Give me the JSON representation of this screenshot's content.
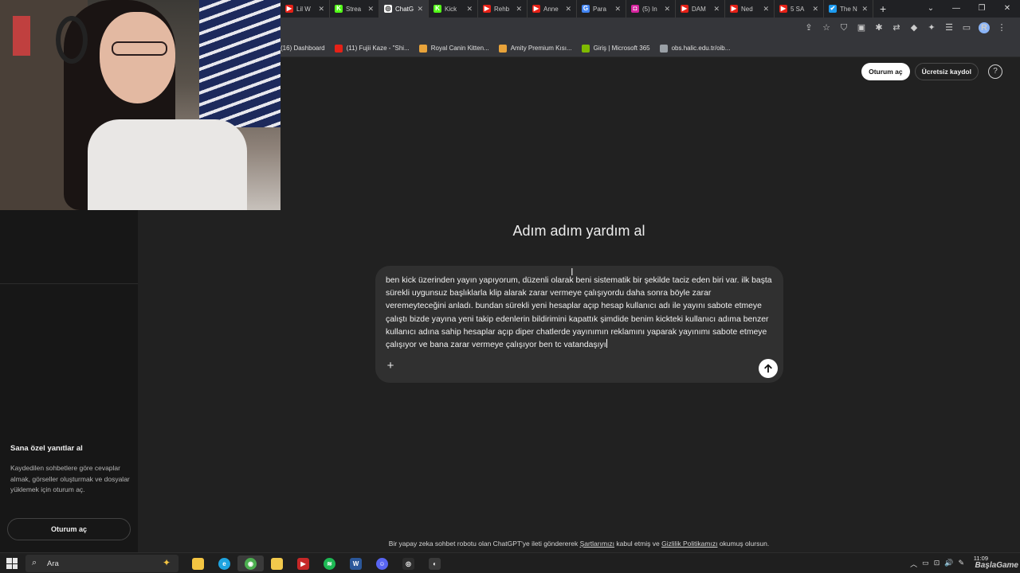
{
  "browser": {
    "tabs": [
      {
        "title": "",
        "fav_color": "#202124",
        "fav_glyph": ""
      },
      {
        "title": "Lil W",
        "fav_color": "#e62117",
        "fav_glyph": "▶"
      },
      {
        "title": "Strea",
        "fav_color": "#53fc18",
        "fav_glyph": "K"
      },
      {
        "title": "ChatG",
        "fav_color": "#ffffff",
        "fav_glyph": "◎",
        "active": true
      },
      {
        "title": "Kick",
        "fav_color": "#53fc18",
        "fav_glyph": "K"
      },
      {
        "title": "Rehb",
        "fav_color": "#e62117",
        "fav_glyph": "▶"
      },
      {
        "title": "Anne",
        "fav_color": "#e62117",
        "fav_glyph": "▶"
      },
      {
        "title": "Para",
        "fav_color": "#4285f4",
        "fav_glyph": "G"
      },
      {
        "title": "(5) In",
        "fav_color": "#d6249f",
        "fav_glyph": "◘"
      },
      {
        "title": "DAM",
        "fav_color": "#e62117",
        "fav_glyph": "▶"
      },
      {
        "title": "Ned",
        "fav_color": "#e62117",
        "fav_glyph": "▶"
      },
      {
        "title": "5 SA",
        "fav_color": "#e62117",
        "fav_glyph": "▶"
      },
      {
        "title": "The N",
        "fav_color": "#1d9bf0",
        "fav_glyph": "✔"
      }
    ],
    "new_tab": "+",
    "window_controls": [
      "⌄",
      "—",
      "❐",
      "✕"
    ],
    "toolbar_icons": [
      "⇪",
      "☆",
      "⛉",
      "▣",
      "✱",
      "⇄",
      "◆",
      "✦",
      "☰",
      "▭"
    ],
    "avatar_letter": "R",
    "menu_icon": "⋮",
    "bookmarks": [
      {
        "label": "(16) Dashboard",
        "color": "#35363a"
      },
      {
        "label": "(11) Fujii Kaze - \"Shi...",
        "color": "#e62117"
      },
      {
        "label": "Royal Canin Kitten...",
        "color": "#e8a33a"
      },
      {
        "label": "Amity Premium Kısı...",
        "color": "#e8a33a"
      },
      {
        "label": "Giriş | Microsoft 365",
        "color": "#7fba00"
      },
      {
        "label": "obs.halic.edu.tr/oib...",
        "color": "#9aa0a6"
      }
    ]
  },
  "header": {
    "login_label": "Oturum aç",
    "signup_label": "Ücretsiz kaydol",
    "help_glyph": "?"
  },
  "sidebar": {
    "promo_title": "Sana özel yanıtlar al",
    "promo_desc": "Kaydedilen sohbetlere göre cevaplar almak, görseller oluşturmak ve dosyalar yüklemek için oturum aç.",
    "login_label": "Oturum aç"
  },
  "main": {
    "headline": "Adım adım yardım al",
    "composer_text": "ben kick üzerinden yayın yapıyorum, düzenli olarak beni sistematik bir şekilde taciz eden biri var. ilk başta sürekli uygunsuz başlıklarla klip alarak zarar vermeye çalışıyordu daha sonra böyle zarar veremeyteceğini anladı. bundan sürekli yeni hesaplar açıp hesap kullanıcı adı ile yayını sabote etmeye çalıştı bizde yayına yeni takip edenlerin bildirimini kapattık şimdide benim kickteki kullanıcı adıma benzer kullanıcı adına sahip hesaplar açıp diper chatlerde yayınımın reklamını yaparak yayınımı sabote etmeye çalışıyor ve bana zarar vermeye çalışıyor ben tc vatandaşıyı",
    "add_glyph": "+"
  },
  "footer": {
    "prefix": "Bir yapay zeka sohbet robotu olan ChatGPT'ye ileti göndererek ",
    "terms": "Şartlarımızı",
    "middle": " kabul etmiş ve ",
    "privacy": "Gizlilik Politikamızı",
    "suffix": " okumuş olursun."
  },
  "taskbar": {
    "search_placeholder": "Ara",
    "search_icon": "⌕",
    "search_deco": "✦",
    "apps": [
      {
        "name": "file-explorer",
        "color": "#f4c542",
        "glyph": ""
      },
      {
        "name": "edge",
        "color": "#1fa4e0",
        "glyph": "e"
      },
      {
        "name": "chrome",
        "color": "#4caf50",
        "glyph": "◉",
        "active": true
      },
      {
        "name": "notes",
        "color": "#f2c94c",
        "glyph": ""
      },
      {
        "name": "video-editor",
        "color": "#c62828",
        "glyph": "▶"
      },
      {
        "name": "spotify",
        "color": "#1db954",
        "glyph": "≋"
      },
      {
        "name": "word",
        "color": "#2b579a",
        "glyph": "W"
      },
      {
        "name": "discord",
        "color": "#5865f2",
        "glyph": "☺"
      },
      {
        "name": "obs",
        "color": "#2d2d2d",
        "glyph": "◎"
      },
      {
        "name": "app",
        "color": "#3a3a3a",
        "glyph": "◐"
      }
    ],
    "tray": [
      "︿",
      "▭",
      "⊡",
      "🔊",
      "✎"
    ],
    "time": "11:09",
    "watermark": "BaşlaGame"
  }
}
